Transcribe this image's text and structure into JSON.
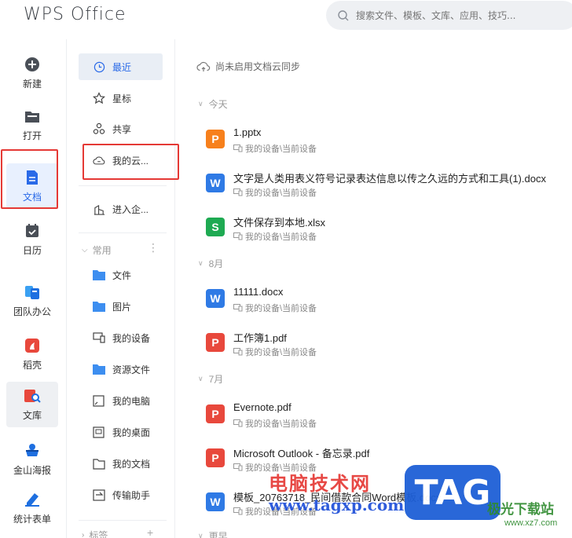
{
  "app": {
    "title": "WPS Office"
  },
  "search": {
    "placeholder": "搜索文件、模板、文库、应用、技巧..."
  },
  "rail": {
    "items": [
      {
        "label": "新建",
        "icon": "plus-circle-icon"
      },
      {
        "label": "打开",
        "icon": "folder-open-icon"
      },
      {
        "label": "文档",
        "icon": "document-icon"
      },
      {
        "label": "日历",
        "icon": "calendar-icon"
      },
      {
        "label": "团队办公",
        "icon": "team-office-icon"
      },
      {
        "label": "稻壳",
        "icon": "docer-icon"
      },
      {
        "label": "文库",
        "icon": "library-icon"
      },
      {
        "label": "金山海报",
        "icon": "poster-icon"
      },
      {
        "label": "统计表单",
        "icon": "form-icon"
      }
    ]
  },
  "nav": {
    "items": [
      {
        "label": "最近",
        "icon": "clock-icon"
      },
      {
        "label": "星标",
        "icon": "star-icon"
      },
      {
        "label": "共享",
        "icon": "share-icon"
      },
      {
        "label": "我的云...",
        "icon": "cloud-icon"
      },
      {
        "label": "进入企...",
        "icon": "enterprise-icon"
      }
    ],
    "common_group": "常用",
    "common_items": [
      {
        "label": "文件",
        "icon": "folder-icon"
      },
      {
        "label": "图片",
        "icon": "folder-icon"
      },
      {
        "label": "我的设备",
        "icon": "device-icon"
      },
      {
        "label": "资源文件",
        "icon": "folder-icon"
      },
      {
        "label": "我的电脑",
        "icon": "computer-icon"
      },
      {
        "label": "我的桌面",
        "icon": "desktop-icon"
      },
      {
        "label": "我的文档",
        "icon": "my-docs-icon"
      },
      {
        "label": "传输助手",
        "icon": "transfer-icon"
      }
    ],
    "tags_group": "标签"
  },
  "content": {
    "cloud_sync_note": "尚未启用文档云同步",
    "groups": [
      {
        "label": "今天",
        "files": [
          {
            "name": "1.pptx",
            "location": "我的设备\\当前设备",
            "type": "ppt",
            "glyph": "P",
            "color": "#f7801c"
          },
          {
            "name": "文字是人类用表义符号记录表达信息以传之久远的方式和工具(1).docx",
            "location": "我的设备\\当前设备",
            "type": "word",
            "glyph": "W",
            "color": "#2f7ae5"
          },
          {
            "name": "文件保存到本地.xlsx",
            "location": "我的设备\\当前设备",
            "type": "excel",
            "glyph": "S",
            "color": "#1eaa52"
          }
        ]
      },
      {
        "label": "8月",
        "files": [
          {
            "name": "11111.docx",
            "location": "我的设备\\当前设备",
            "type": "word",
            "glyph": "W",
            "color": "#2f7ae5"
          },
          {
            "name": "工作簿1.pdf",
            "location": "我的设备\\当前设备",
            "type": "pdf",
            "glyph": "P",
            "color": "#e8483c"
          }
        ]
      },
      {
        "label": "7月",
        "files": [
          {
            "name": "Evernote.pdf",
            "location": "我的设备\\当前设备",
            "type": "pdf",
            "glyph": "P",
            "color": "#e8483c"
          },
          {
            "name": "Microsoft Outlook - 备忘录.pdf",
            "location": "我的设备\\当前设备",
            "type": "pdf",
            "glyph": "P",
            "color": "#e8483c"
          },
          {
            "name": "模板_20763718_民间借款合同Word模板.docx",
            "location": "我的设备\\当前设备",
            "type": "word",
            "glyph": "W",
            "color": "#2f7ae5"
          }
        ]
      },
      {
        "label": "更早",
        "files": []
      }
    ]
  },
  "watermark": {
    "site_cn": "电脑技术网",
    "site_url": "www.tagxp.com",
    "tag": "TAG",
    "site2_cn": "极光下载站",
    "site2_url": "www.xz7.com"
  }
}
